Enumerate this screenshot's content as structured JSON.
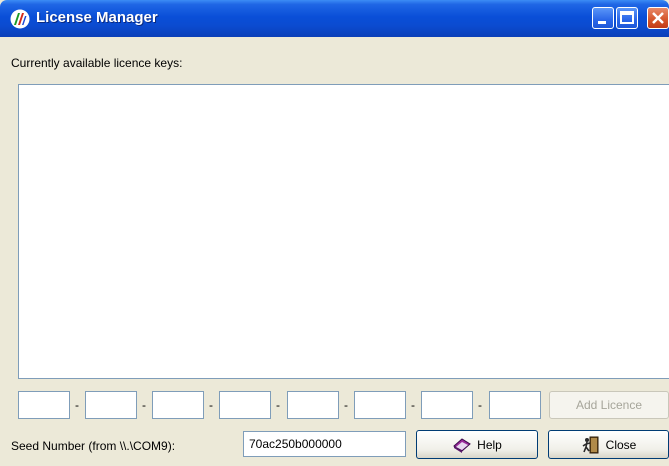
{
  "window": {
    "title": "License Manager"
  },
  "list": {
    "label": "Currently available licence keys:",
    "items": []
  },
  "keys": {
    "segments": [
      "",
      "",
      "",
      "",
      "",
      "",
      "",
      ""
    ],
    "separator": "-"
  },
  "buttons": {
    "add": "Add Licence",
    "help": "Help",
    "close": "Close"
  },
  "seed": {
    "label": "Seed Number (from \\\\.\\COM9):",
    "value": "70ac250b000000"
  },
  "colors": {
    "titlebar": "#0a4fd8",
    "window_bg": "#ece9d8",
    "field_border": "#7f9db9"
  },
  "icons": {
    "app": "license-manager-app-icon",
    "help": "help-book-icon",
    "close": "exit-door-icon"
  }
}
